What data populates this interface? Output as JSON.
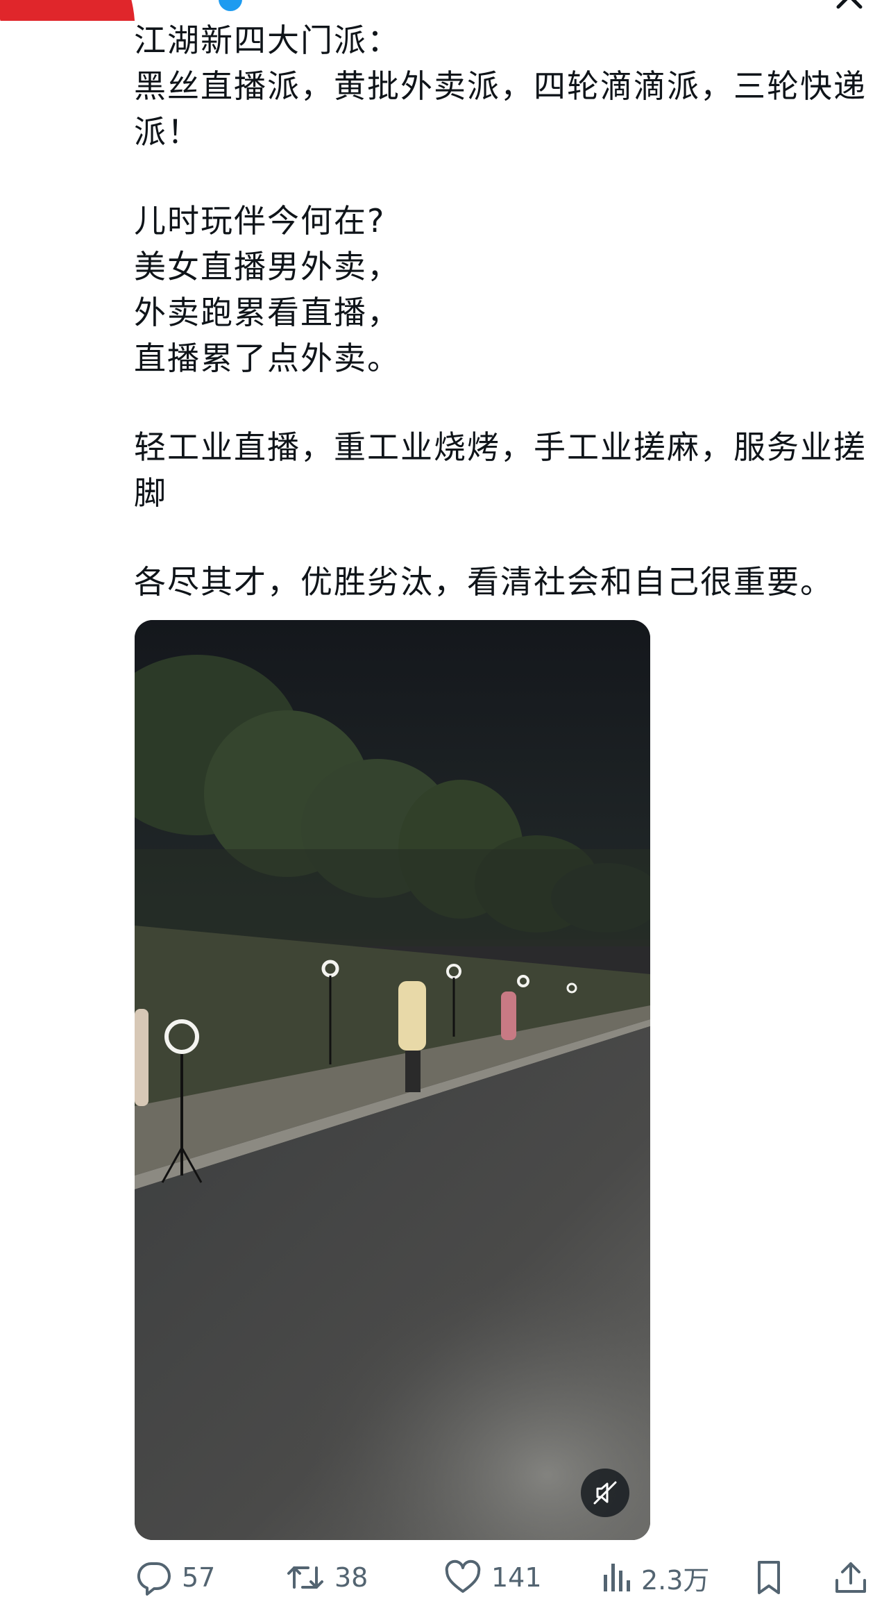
{
  "header": {
    "name": "",
    "handle": ""
  },
  "tweet": {
    "lines": [
      "江湖新四大门派：",
      "黑丝直播派，黄批外卖派，四轮滴滴派，三轮快递",
      "派！",
      "",
      "儿时玩伴今何在?",
      "美女直播男外卖，",
      "外卖跑累看直播，",
      "直播累了点外卖。",
      "",
      "轻工业直播，重工业烧烤，手工业搓麻，服务业搓",
      "脚",
      "",
      "各尽其才，优胜劣汰，看清社会和自己很重要。"
    ]
  },
  "video": {
    "muted": true
  },
  "actions": {
    "replies": "57",
    "reposts": "38",
    "likes": "141",
    "views": "2.3万"
  },
  "colors": {
    "text": "#0f1419",
    "secondary": "#536471",
    "accent": "#1d9bf0",
    "avatar_redaction": "#e0262b"
  }
}
